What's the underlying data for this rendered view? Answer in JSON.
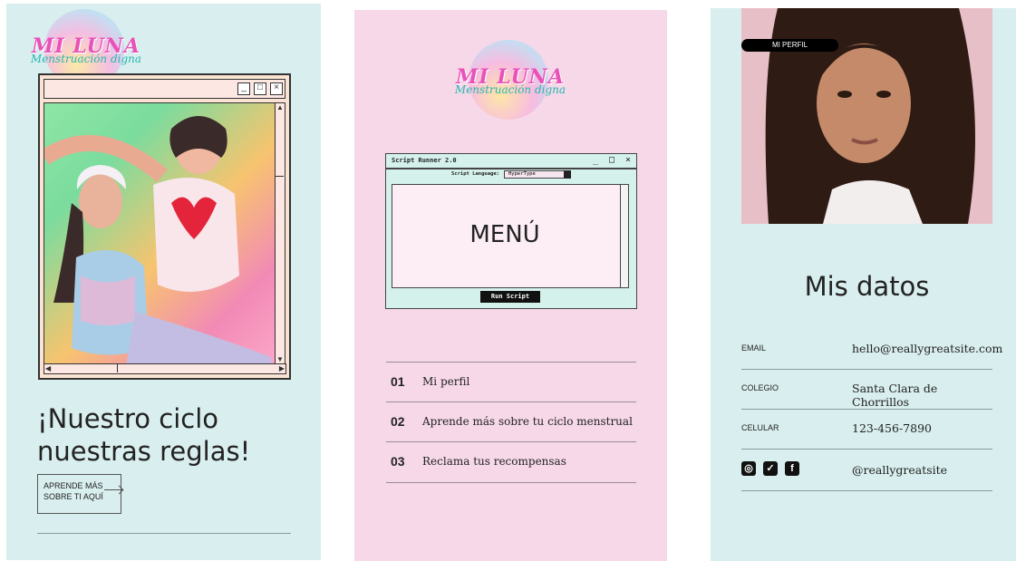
{
  "panel1": {
    "logo": {
      "line1": "MI LUNA",
      "line2": "Menstruación digna"
    },
    "window": {
      "minimize": "_",
      "maximize": "□",
      "close": "×"
    },
    "headline": "¡Nuestro ciclo nuestras reglas!",
    "cta": "APRENDE MÁS SOBRE TI AQUÍ"
  },
  "panel2": {
    "logo": {
      "line1": "MI LUNA",
      "line2": "Menstruación digna"
    },
    "script_runner": {
      "title": "Script Runner 2.0",
      "minimize": "_",
      "maximize": "□",
      "close": "×",
      "language_label": "Script Language:",
      "language_value": "HyperType",
      "content": "MENÚ",
      "run_button": "Run Script"
    },
    "menu": [
      {
        "num": "01",
        "label": "Mi perfil"
      },
      {
        "num": "02",
        "label": "Aprende más sobre tu ciclo menstrual"
      },
      {
        "num": "03",
        "label": "Reclama tus recompensas"
      }
    ]
  },
  "panel3": {
    "badge": "MI PERFIL",
    "title": "Mis datos",
    "rows": [
      {
        "key": "EMAIL",
        "value": "hello@reallygreatsite.com"
      },
      {
        "key": "COLEGIO",
        "value": "Santa Clara de Chorrillos"
      },
      {
        "key": "CELULAR",
        "value": "123-456-7890"
      }
    ],
    "social": {
      "icons": [
        "instagram-icon",
        "twitter-icon",
        "facebook-icon"
      ],
      "handle": "@reallygreatsite"
    }
  },
  "colors": {
    "mint": "#d9eeee",
    "pink": "#f6d8e8",
    "logo_pink": "#e852b9",
    "logo_teal": "#25b8b0"
  }
}
